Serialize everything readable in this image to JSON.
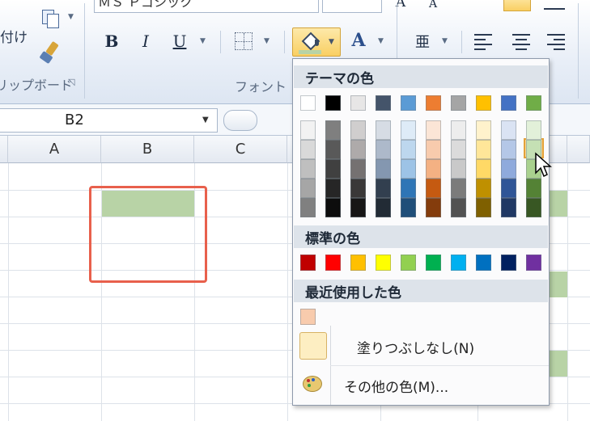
{
  "ribbon": {
    "clipboard_group": "クリップボード",
    "paste_fragment": "付け",
    "font_group": "フォント",
    "bold": "B",
    "italic": "I",
    "underline": "U",
    "font_color": "A",
    "font_size_grow": "A",
    "font_size_shrink": "A",
    "font_name_partial": "ＭＳ Ｐゴシック",
    "phonetic_label": "亜"
  },
  "namebox": {
    "value": "B2"
  },
  "columns": [
    "A",
    "B",
    "C"
  ],
  "highlight_color": "#b8d3a6",
  "selection_border": "#e8604c",
  "fill_menu": {
    "theme_header": "テーマの色",
    "standard_header": "標準の色",
    "recent_header": "最近使用した色",
    "no_fill": "塗りつぶしなし(N)",
    "more_colors": "その他の色(M)...",
    "theme_top": [
      "#ffffff",
      "#000000",
      "#e7e6e6",
      "#44546a",
      "#5b9bd5",
      "#ed7d31",
      "#a5a5a5",
      "#ffc000",
      "#4472c4",
      "#70ad47"
    ],
    "theme_shades": [
      [
        "#f2f2f2",
        "#d9d9d9",
        "#bfbfbf",
        "#a6a6a6",
        "#808080"
      ],
      [
        "#7f7f7f",
        "#595959",
        "#404040",
        "#262626",
        "#0d0d0d"
      ],
      [
        "#d0cece",
        "#aeaaaa",
        "#757171",
        "#3a3838",
        "#171616"
      ],
      [
        "#d6dce4",
        "#adb9ca",
        "#8497b0",
        "#323f4f",
        "#222b35"
      ],
      [
        "#deebf7",
        "#bdd7ee",
        "#9dc3e6",
        "#2e75b6",
        "#1f4e79"
      ],
      [
        "#fbe5d6",
        "#f8cbad",
        "#f4b183",
        "#c55a11",
        "#843c0c"
      ],
      [
        "#ededed",
        "#dbdbdb",
        "#c9c9c9",
        "#7b7b7b",
        "#525252"
      ],
      [
        "#fff2cc",
        "#ffe699",
        "#ffd966",
        "#bf9000",
        "#7f6000"
      ],
      [
        "#dae3f3",
        "#b4c7e7",
        "#8faadc",
        "#2f5597",
        "#203864"
      ],
      [
        "#e2f0d9",
        "#c5e0b4",
        "#a9d18e",
        "#548235",
        "#385723"
      ]
    ],
    "standard": [
      "#c00000",
      "#ff0000",
      "#ffc000",
      "#ffff00",
      "#92d050",
      "#00b050",
      "#00b0f0",
      "#0070c0",
      "#002060",
      "#7030a0"
    ],
    "recent": [
      "#f8cbad"
    ]
  }
}
